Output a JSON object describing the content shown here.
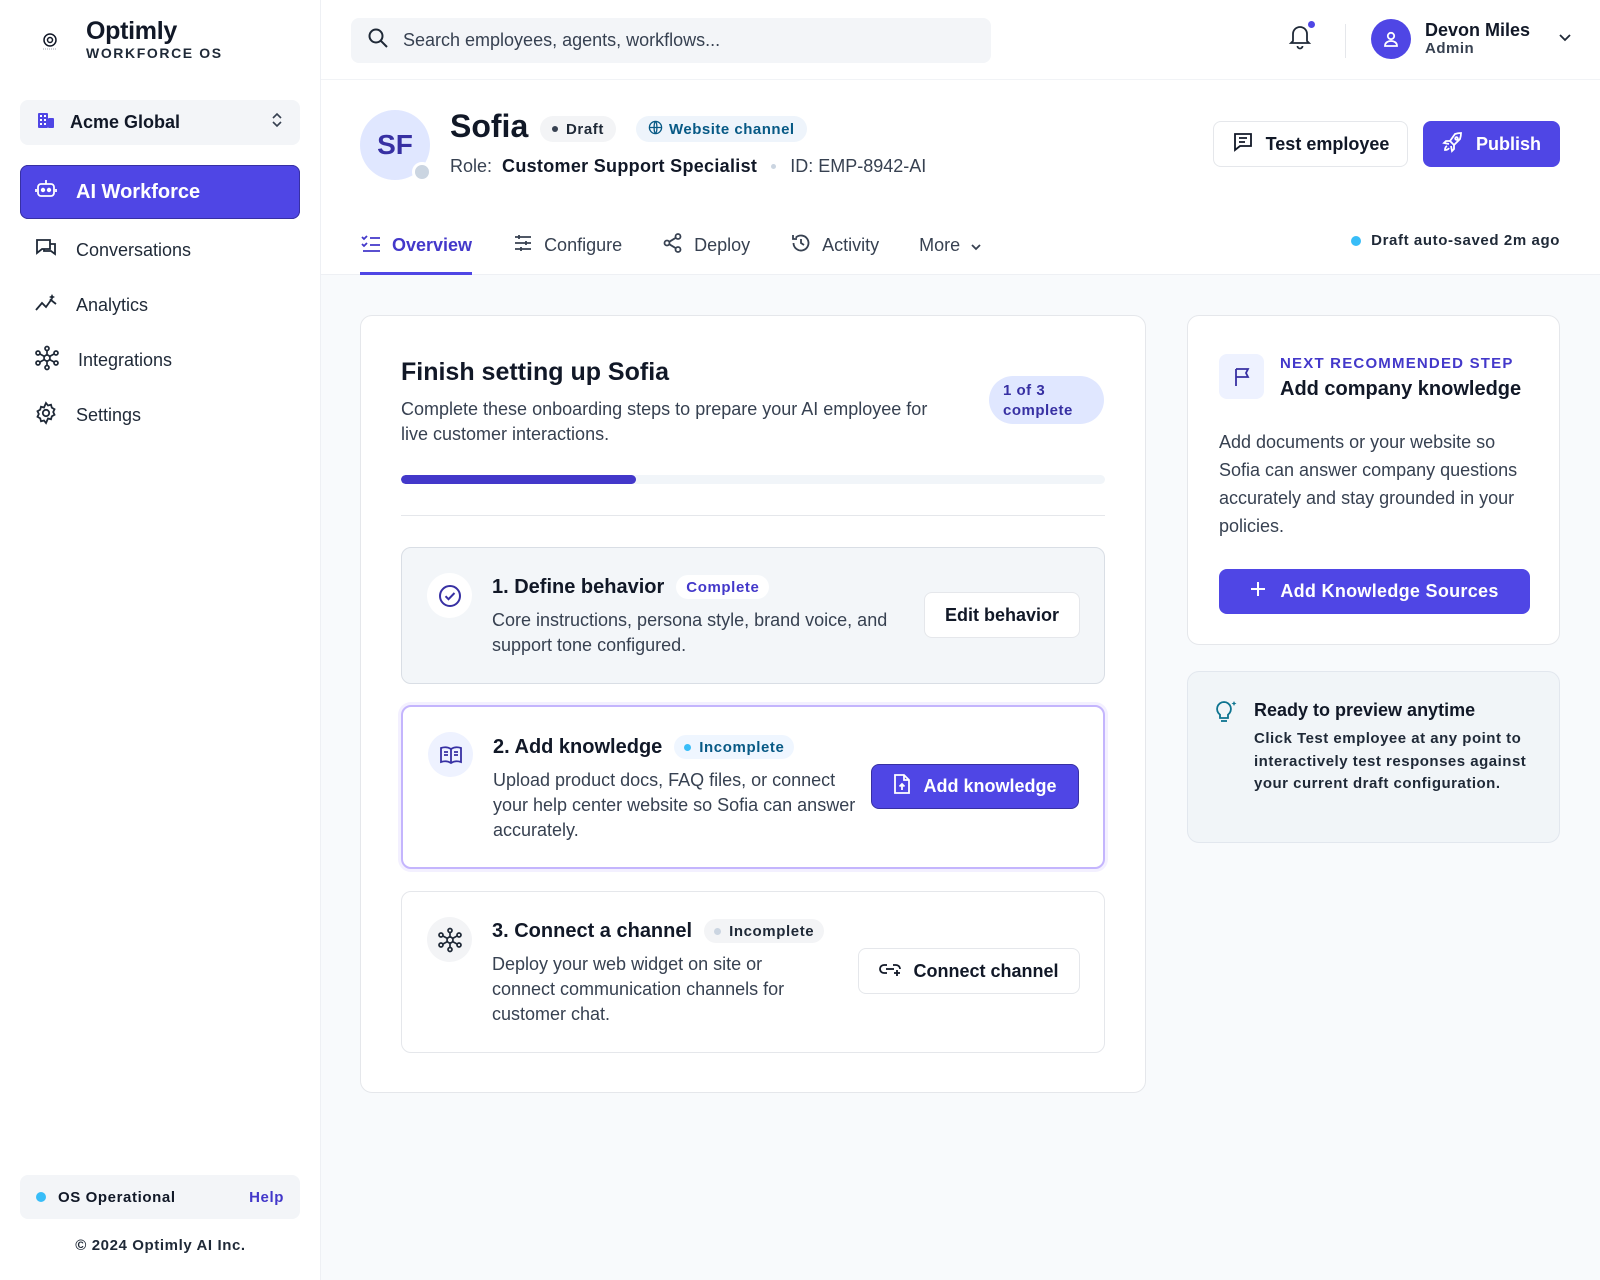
{
  "brand": {
    "name": "Optimly",
    "subtitle": "WORKFORCE OS"
  },
  "org": {
    "name": "Acme Global"
  },
  "nav": {
    "items": [
      {
        "label": "AI Workforce",
        "icon": "robot-icon",
        "active": true
      },
      {
        "label": "Conversations",
        "icon": "chat-icon"
      },
      {
        "label": "Analytics",
        "icon": "analytics-icon"
      },
      {
        "label": "Integrations",
        "icon": "integrations-icon"
      },
      {
        "label": "Settings",
        "icon": "gear-icon"
      }
    ]
  },
  "status": {
    "text": "OS Operational",
    "help": "Help"
  },
  "copyright": "© 2024 Optimly AI Inc.",
  "search": {
    "placeholder": "Search employees, agents, workflows..."
  },
  "user": {
    "name": "Devon Miles",
    "role": "Admin"
  },
  "employee": {
    "initials": "SF",
    "name": "Sofia",
    "status": "Draft",
    "channel": "Website channel",
    "role_label": "Role:",
    "role": "Customer Support Specialist",
    "id": "ID: EMP-8942-AI"
  },
  "actions": {
    "test": "Test employee",
    "publish": "Publish"
  },
  "tabs": [
    {
      "label": "Overview",
      "icon": "checklist-icon",
      "active": true
    },
    {
      "label": "Configure",
      "icon": "sliders-icon"
    },
    {
      "label": "Deploy",
      "icon": "share-icon"
    },
    {
      "label": "Activity",
      "icon": "history-icon"
    },
    {
      "label": "More",
      "icon": "chevron-down-icon"
    }
  ],
  "autosave": "Draft auto-saved 2m ago",
  "setup": {
    "title": "Finish setting up Sofia",
    "subtitle": "Complete these onboarding steps to prepare your AI employee for live customer interactions.",
    "progress_text": "1 of 3 complete",
    "progress": {
      "done": 1,
      "total": 3
    },
    "steps": [
      {
        "title": "1. Define behavior",
        "status": "Complete",
        "desc": "Core instructions, persona style, brand voice, and support tone configured.",
        "action": "Edit behavior"
      },
      {
        "title": "2. Add knowledge",
        "status": "Incomplete",
        "desc": "Upload product docs, FAQ files, or connect your help center website so Sofia can answer accurately.",
        "action": "Add knowledge"
      },
      {
        "title": "3. Connect a channel",
        "status": "Incomplete",
        "desc": "Deploy your web widget on site or connect communication channels for customer chat.",
        "action": "Connect channel"
      }
    ]
  },
  "next": {
    "label": "NEXT RECOMMENDED STEP",
    "title": "Add company knowledge",
    "desc": "Add documents or your website so Sofia can answer company questions accurately and stay grounded in your policies.",
    "button": "Add Knowledge Sources"
  },
  "preview": {
    "title": "Ready to preview anytime",
    "desc": "Click Test employee at any point to interactively test responses against your current draft configuration."
  },
  "colors": {
    "accent": "#4f46e5",
    "accent_dark": "#4338ca",
    "info": "#38bdf8"
  }
}
